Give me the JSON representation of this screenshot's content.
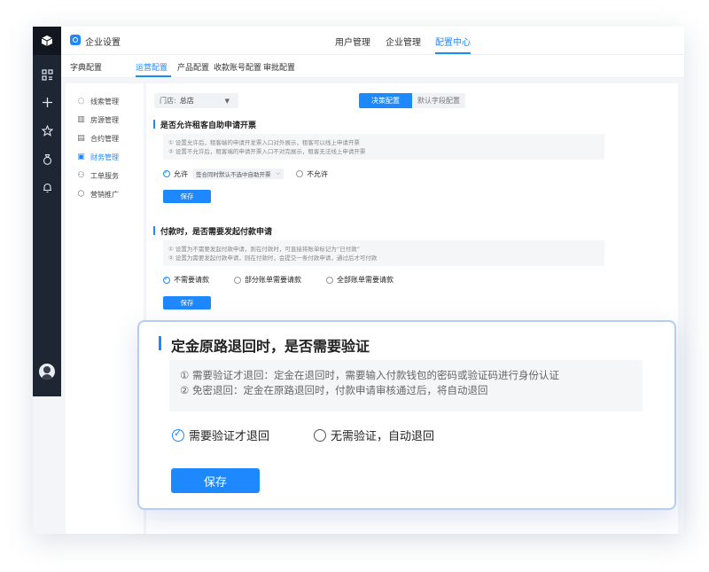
{
  "app": {
    "title": "企业设置"
  },
  "top_nav": [
    {
      "label": "用户管理"
    },
    {
      "label": "企业管理"
    },
    {
      "label": "配置中心",
      "active": true
    }
  ],
  "sub_tabs": [
    {
      "label": "字典配置"
    },
    {
      "label": "运营配置",
      "active": true
    },
    {
      "label": "产品配置"
    },
    {
      "label": "收款账号配置"
    },
    {
      "label": "审批配置"
    }
  ],
  "sidebar": {
    "items": [
      {
        "label": "线索管理",
        "icon": "clue-icon"
      },
      {
        "label": "房源管理",
        "icon": "building-icon"
      },
      {
        "label": "合约管理",
        "icon": "contract-icon"
      },
      {
        "label": "财务管理",
        "icon": "finance-icon",
        "active": true
      },
      {
        "label": "工单服务",
        "icon": "workorder-icon"
      },
      {
        "label": "营销推广",
        "icon": "marketing-icon"
      }
    ]
  },
  "filters": {
    "store_label": "门店:",
    "store_value": "总店",
    "segments": [
      "决策配置",
      "默认字段配置"
    ]
  },
  "section1": {
    "title": "是否允许租客自助申请开票",
    "tips": [
      "① 设置允许后，租客端的申请开发票入口对外展示，租客可以线上申请开票",
      "② 设置不允许后，租客端的申请开票入口不对完展示，租客无法线上申请开票"
    ],
    "option_allow": "允许",
    "option_allow_select": "签合同时默认不选中自助开票",
    "option_deny": "不允许",
    "save": "保存"
  },
  "section2": {
    "title": "付款时，是否需要发起付款申请",
    "tips": [
      "① 设置为不需要发起付款申请，则在付款时，可直接将账单标记为“已付款”",
      "② 设置为需要发起付款申请，则在付款时，会提交一条付款申请，通过后才可付款"
    ],
    "options": [
      "不需要请款",
      "部分账单需要请款",
      "全部账单需要请款"
    ],
    "save": "保存"
  },
  "popup": {
    "title": "定金原路退回时，是否需要验证",
    "tips": [
      "① 需要验证才退回：定金在退回时，需要输入付款钱包的密码或验证码进行身份认证",
      "② 免密退回：定金在原路退回时，付款申请审核通过后，将自动退回"
    ],
    "option_verify": "需要验证才退回",
    "option_auto": "无需验证，自动退回",
    "save": "保存"
  },
  "colors": {
    "accent": "#1e88ff",
    "sidebar_bg": "#1f2633"
  }
}
